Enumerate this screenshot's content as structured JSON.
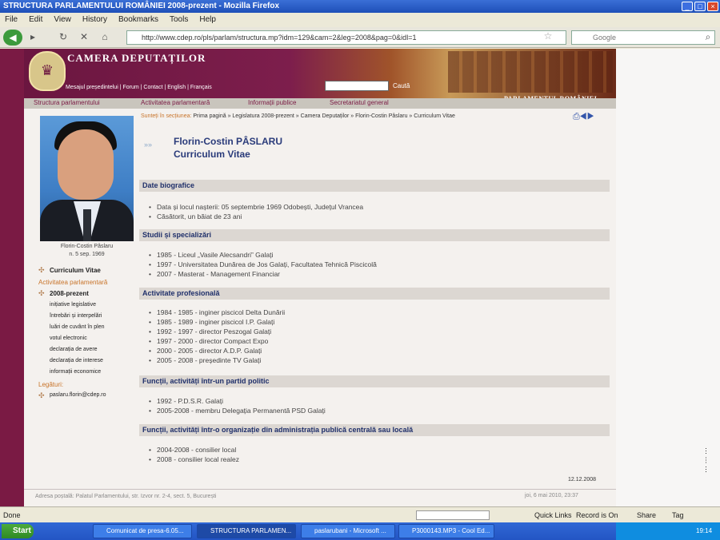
{
  "window": {
    "title": "STRUCTURA PARLAMENTULUI ROMÂNIEI 2008-prezent - Mozilla Firefox"
  },
  "menu": [
    "File",
    "Edit",
    "View",
    "History",
    "Bookmarks",
    "Tools",
    "Help"
  ],
  "browser": {
    "url": "http://www.cdep.ro/pls/parlam/structura.mp?idm=129&cam=2&leg=2008&pag=0&idl=1",
    "search_placeholder": "Google"
  },
  "site": {
    "title": "CAMERA DEPUTAȚILOR",
    "top_links": "Mesajul președintelui | Forum | Contact | English | Français",
    "search_label": "Caută",
    "parliament_label": "PARLAMENTUL ROMÂNIEI",
    "tabs": [
      "Structura parlamentului",
      "Activitatea parlamentară",
      "Informații publice",
      "Secretariatul general"
    ]
  },
  "breadcrumb": {
    "lead": "Sunteți în secțiunea:",
    "path": "Prima pagină » Legislatura 2008-prezent » Camera Deputaților » Florin-Costin Pâslaru » Curriculum Vitae"
  },
  "profile": {
    "name": "Florin-Costin PÂSLARU",
    "subtitle": "Curriculum Vitae",
    "caption_name": "Florin-Costin Pâslaru",
    "caption_born": "n. 5 sep. 1969"
  },
  "sidebar": {
    "cv_link": "Curriculum Vitae",
    "activity_heading": "Activitatea parlamentară",
    "term_link": "2008-prezent",
    "activity_items": [
      "inițiative legislative",
      "întrebări și interpelări",
      "luări de cuvânt în plen",
      "votul electronic",
      "declarația de avere",
      "declarația de interese",
      "informații economice"
    ],
    "contact_heading": "Legături:",
    "email": "paslaru.florin@cdep.ro"
  },
  "sections": [
    {
      "title": "Date biografice",
      "items": [
        "Data și locul nașterii: 05 septembrie 1969 Odobești, Județul Vrancea",
        "Căsătorit, un băiat de 23 ani"
      ]
    },
    {
      "title": "Studii și specializări",
      "items": [
        "1985 - Liceul „Vasile Alecsandri” Galați",
        "1997 - Universitatea Dunărea de Jos Galați, Facultatea Tehnică Piscicolă",
        "2007 - Masterat - Management Financiar"
      ]
    },
    {
      "title": "Activitate profesională",
      "items": [
        "1984 - 1985 - inginer piscicol Delta Dunării",
        "1985 - 1989 - inginer piscicol I.P. Galați",
        "1992 - 1997 - director Peszogal Galați",
        "1997 - 2000 - director Compact Expo",
        "2000 - 2005 - director A.D.P. Galați",
        "2005 - 2008 - președinte TV Galați"
      ]
    },
    {
      "title": "Funcții, activități într-un partid politic",
      "items": [
        "1992 - P.D.S.R. Galați",
        "2005-2008 - membru Delegația Permanentă PSD Galați"
      ]
    },
    {
      "title": "Funcții, activități într-o organizație din administrația publică centrală sau locală",
      "items": [
        "2004-2008 - consilier local",
        "2008 - consilier local realez"
      ]
    }
  ],
  "updated_date": "12.12.2008",
  "footer": {
    "address": "Adresa poștală: Palatul Parlamentului, str. Izvor nr. 2-4, sect. 5, București",
    "timestamp": "joi, 6 mai 2010, 23:37"
  },
  "status": {
    "text": "Done",
    "quicklinks": "Quick Links",
    "record": "Record is On",
    "share": "Share",
    "tag": "Tag"
  },
  "taskbar": {
    "start": "Start",
    "tasks": [
      "Comunicat de presa-6.05...",
      "STRUCTURA PARLAMEN...",
      "paslarubani - Microsoft ...",
      "P3000143.MP3 - Cool Ed..."
    ],
    "clock": "19:14"
  }
}
